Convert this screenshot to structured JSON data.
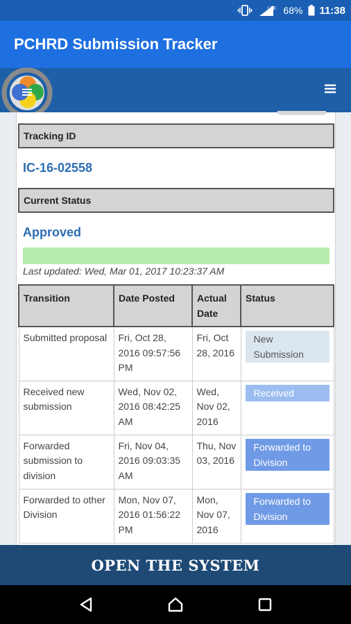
{
  "status_bar": {
    "battery": "68%",
    "time": "11:38",
    "network": "LTE"
  },
  "app_bar": {
    "title": "PCHRD Submission Tracker"
  },
  "tracking": {
    "header": "Tracking ID",
    "value": "IC-16-02558"
  },
  "current_status": {
    "header": "Current Status",
    "value": "Approved",
    "progress_fraction": 1.0,
    "last_updated": "Last updated: Wed, Mar 01, 2017 10:23:37 AM"
  },
  "table": {
    "columns": [
      "Transition",
      "Date Posted",
      "Actual Date",
      "Status"
    ],
    "rows": [
      {
        "transition": "Submitted proposal",
        "date_posted": "Fri, Oct 28, 2016 09:57:56 PM",
        "actual_date": "Fri, Oct 28, 2016",
        "status": "New Submission"
      },
      {
        "transition": "Received new submission",
        "date_posted": "Wed, Nov 02, 2016 08:42:25 AM",
        "actual_date": "Wed, Nov 02, 2016",
        "status": "Received"
      },
      {
        "transition": "Forwarded submission to division",
        "date_posted": "Fri, Nov 04, 2016 09:03:35 AM",
        "actual_date": "Thu, Nov 03, 2016",
        "status": "Forwarded to Division"
      },
      {
        "transition": "Forwarded to other Division",
        "date_posted": "Mon, Nov 07, 2016 01:56:22 PM",
        "actual_date": "Mon, Nov 07, 2016",
        "status": "Forwarded to Division"
      }
    ]
  },
  "bottom_button": {
    "label": "OPEN THE SYSTEM"
  },
  "colors": {
    "app_bar": "#1e6fe0",
    "web_header": "#1e5fa8",
    "accent_text": "#2d6db3",
    "progress": "#b6ecac",
    "bottom_bar": "#1e4a75"
  },
  "icons": [
    "vibrate-icon",
    "signal-icon",
    "battery-icon",
    "hamburger-menu-icon",
    "back-icon",
    "home-icon",
    "recents-icon",
    "logo"
  ]
}
